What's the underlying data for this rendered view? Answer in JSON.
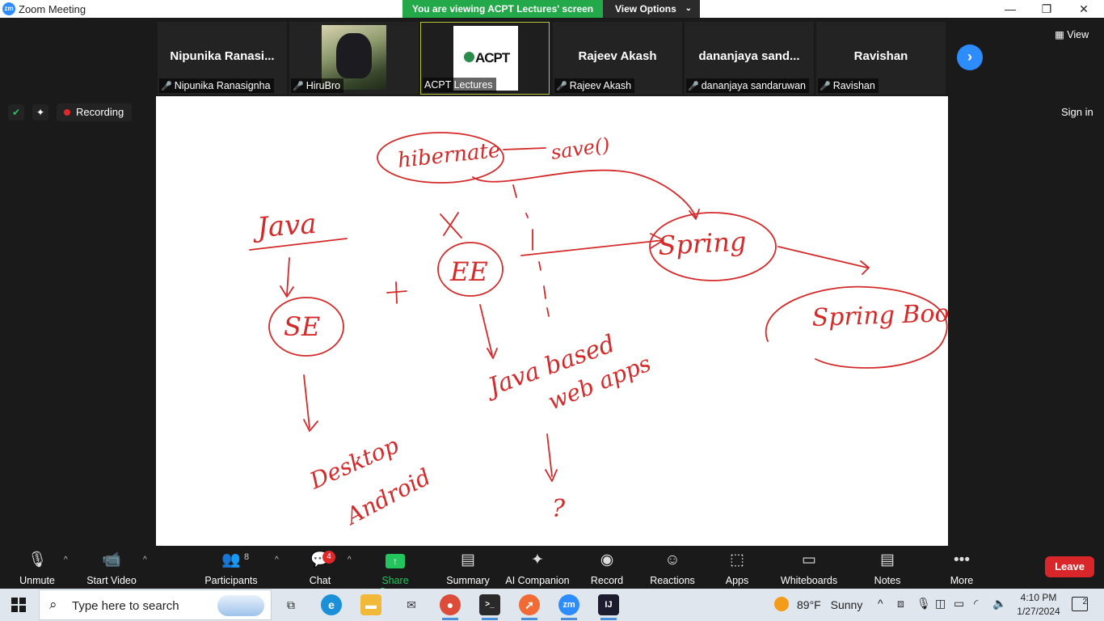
{
  "window": {
    "app_logo": "zm",
    "title": "Zoom Meeting",
    "minimize": "—",
    "restore": "❐",
    "close": "✕"
  },
  "banner": {
    "viewing_text": "You are viewing ACPT Lectures' screen",
    "view_options_label": "View Options"
  },
  "participants": [
    {
      "display": "Nipunika  Ranasi...",
      "label": "Nipunika Ranasignha",
      "muted": true,
      "kind": "name"
    },
    {
      "display": "",
      "label": "HiruBro",
      "muted": true,
      "kind": "image"
    },
    {
      "display": "",
      "label": "ACPT Lectures",
      "muted": false,
      "kind": "logo",
      "logo_text": "ACPT"
    },
    {
      "display": "Rajeev Akash",
      "label": "Rajeev Akash",
      "muted": true,
      "kind": "name"
    },
    {
      "display": "dananjaya  sand...",
      "label": "dananjaya sandaruwan",
      "muted": true,
      "kind": "name"
    },
    {
      "display": "Ravishan",
      "label": "Ravishan",
      "muted": true,
      "kind": "name"
    }
  ],
  "strip": {
    "view_label": "View",
    "next_icon": "chevron-right-icon"
  },
  "status": {
    "recording_label": "Recording",
    "sign_in_label": "Sign in"
  },
  "whiteboard": {
    "words": [
      "hibernate",
      "save()",
      "Java",
      "SE",
      "EE",
      "Spring",
      "Spring Boot",
      "Java based",
      "web apps",
      "Desktop",
      "Android",
      "?"
    ],
    "ink_color": "#d42a2a"
  },
  "toolbar": {
    "unmute": "Unmute",
    "start_video": "Start Video",
    "participants": "Participants",
    "participants_count": "8",
    "chat": "Chat",
    "chat_badge": "4",
    "share_screen": "Share Screen",
    "summary": "Summary",
    "ai_companion": "AI Companion",
    "record": "Record",
    "reactions": "Reactions",
    "apps": "Apps",
    "whiteboards": "Whiteboards",
    "notes": "Notes",
    "more": "More",
    "leave": "Leave"
  },
  "taskbar": {
    "search_placeholder": "Type here to search",
    "weather_temp": "89°F",
    "weather_text": "Sunny",
    "time": "4:10 PM",
    "date": "1/27/2024",
    "notification_count": "2"
  },
  "colors": {
    "accent_blue": "#2d8cff",
    "banner_green": "#23a84a",
    "leave_red": "#d9262b",
    "muted_red": "#e02828"
  }
}
